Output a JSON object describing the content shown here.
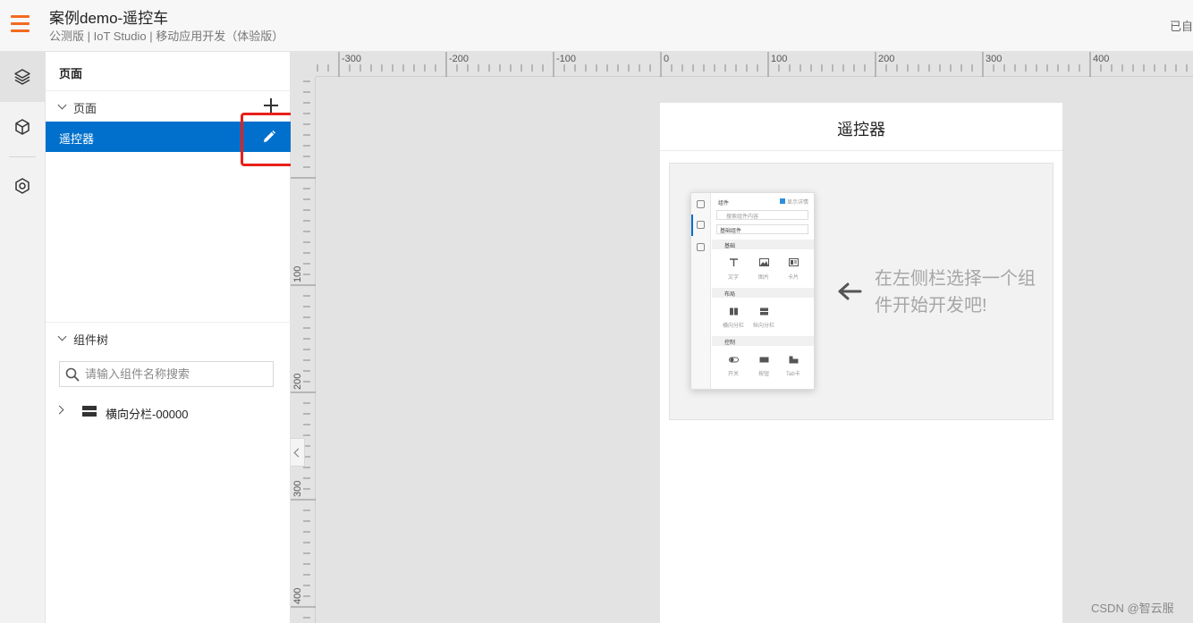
{
  "header": {
    "title": "案例demo-遥控车",
    "subtitle": "公测版 | IoT Studio | 移动应用开发（体验版）",
    "right_text": "已自",
    "accent_color": "#f26a21"
  },
  "rail": {
    "items": [
      {
        "icon": "layers-icon",
        "active": true
      },
      {
        "icon": "cube-icon",
        "active": false
      },
      {
        "icon": "hexagon-settings-icon",
        "active": false
      }
    ]
  },
  "panel": {
    "title": "页面",
    "pages_section": "页面",
    "pages": [
      {
        "label": "遥控器",
        "selected": true
      }
    ],
    "tree_section": "组件树",
    "search_placeholder": "请输入组件名称搜索",
    "tree_nodes": [
      {
        "label": "横向分栏-00000",
        "icon": "horizontal-split-icon"
      }
    ]
  },
  "ruler": {
    "top_labels": [
      "-300",
      "-200",
      "-100",
      "0",
      "100",
      "200",
      "300",
      "400"
    ],
    "left_labels": [
      "100",
      "200",
      "300",
      "400"
    ]
  },
  "phone": {
    "title": "遥控器",
    "empty_text": "在左侧栏选择一个组件开始开发吧!",
    "mini": {
      "header": "组件",
      "checkbox_label": "显示详情",
      "search_placeholder": "搜索组件内容",
      "select_value": "基础组件",
      "sections": [
        {
          "title": "基础",
          "items": [
            "文字",
            "图片",
            "卡片"
          ]
        },
        {
          "title": "布局",
          "items": [
            "横向分栏",
            "纵向分栏"
          ]
        },
        {
          "title": "控制",
          "items": [
            "开关",
            "按钮",
            "Tab卡"
          ]
        }
      ]
    }
  },
  "colors": {
    "selected_bg": "#0070cc",
    "highlight": "#e8201a"
  },
  "watermark": "CSDN @智云服"
}
